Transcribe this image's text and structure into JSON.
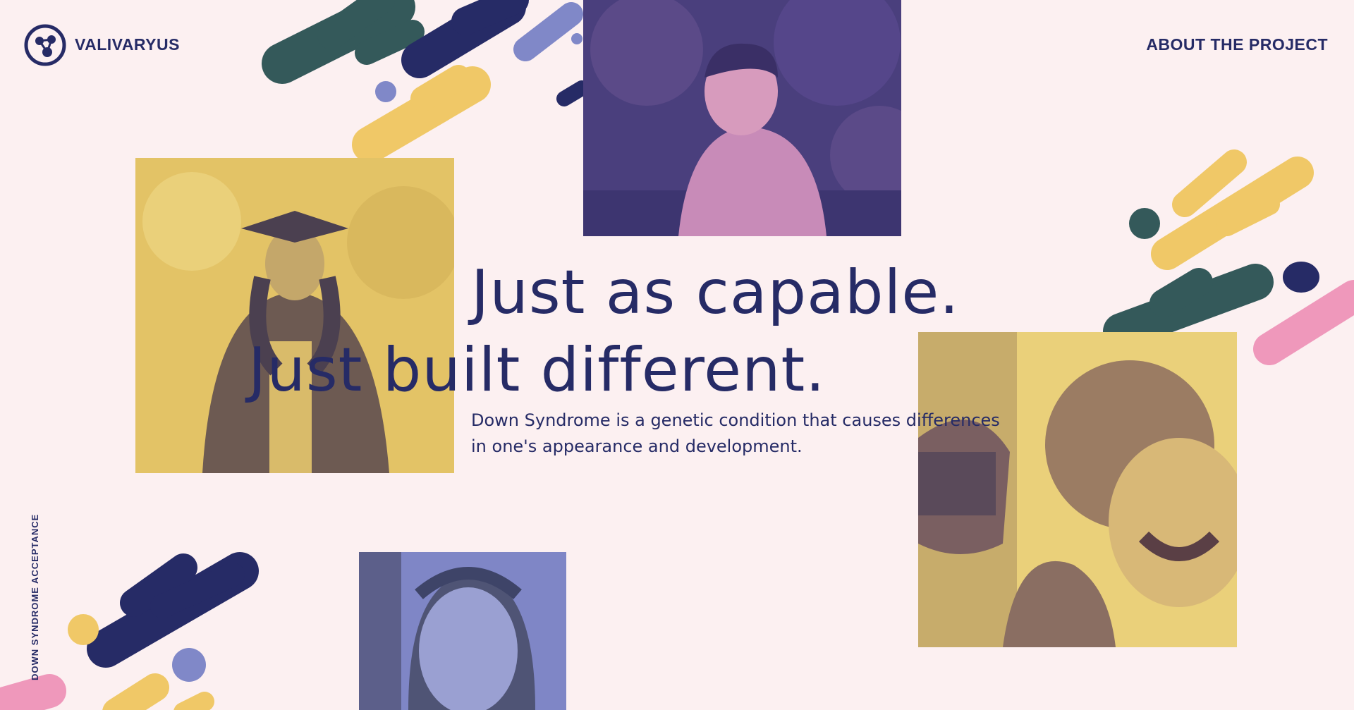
{
  "brand": {
    "name": "VALIVARYUS",
    "logo_icon": "molecule-logo-icon"
  },
  "nav": {
    "about_label": "ABOUT THE PROJECT"
  },
  "side_label": "DOWN SYNDROME ACCEPTANCE",
  "hero": {
    "line1": "Just as capable.",
    "line2": "Just built different.",
    "description_line1": "Down Syndrome is a genetic condition that causes differences",
    "description_line2": "in one's appearance and development."
  },
  "colors": {
    "background": "#fcf0f1",
    "navy": "#262b66",
    "yellow": "#f0c867",
    "teal": "#34595a",
    "periwinkle": "#8088c8",
    "pink": "#ef98bb"
  }
}
